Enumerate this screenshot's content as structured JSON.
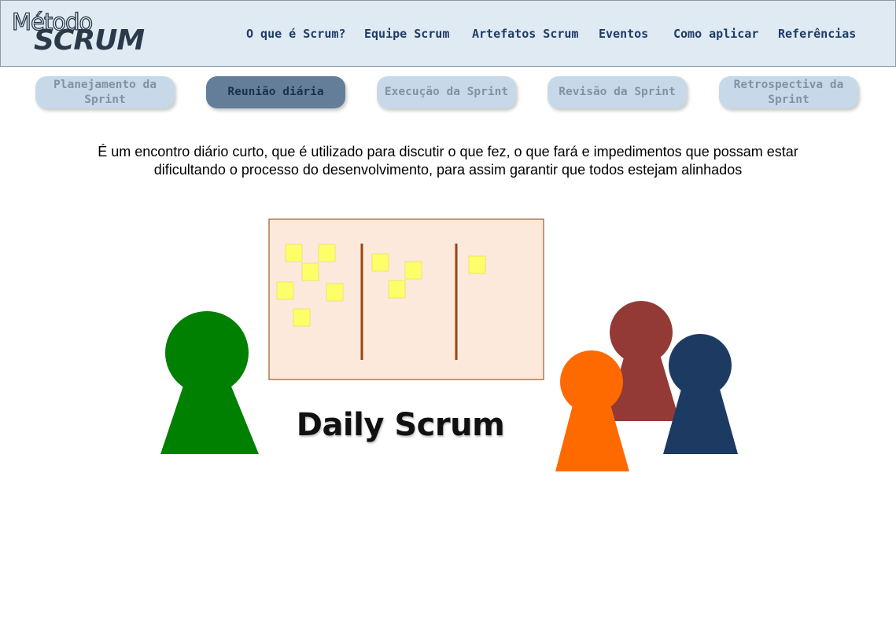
{
  "logo": {
    "line1": "Método",
    "line2": "SCRUM"
  },
  "nav": [
    {
      "label": "O que é Scrum?"
    },
    {
      "label": "Equipe Scrum"
    },
    {
      "label": "Artefatos Scrum"
    },
    {
      "label": "Eventos"
    },
    {
      "label": "Como aplicar"
    },
    {
      "label": "Referências"
    }
  ],
  "tabs": [
    {
      "label": "Planejamento da Sprint",
      "active": false
    },
    {
      "label": "Reunião diária",
      "active": true
    },
    {
      "label": "Execução da Sprint",
      "active": false
    },
    {
      "label": "Revisão da Sprint",
      "active": false
    },
    {
      "label": "Retrospectiva da Sprint",
      "active": false
    }
  ],
  "description": "É um encontro diário curto, que é utilizado para discutir o que fez, o que fará e impedimentos que possam estar dificultando o processo do desenvolvimento, para assim garantir que todos estejam alinhados",
  "illustration": {
    "caption": "Daily Scrum",
    "colors": {
      "board": "#fde9dc",
      "board_border": "#9c5a2c",
      "sticky": "#fefe6a",
      "divider": "#a0420d",
      "person_green": "#008000",
      "person_orange": "#ff6a00",
      "person_red": "#943a36",
      "person_navy": "#1d3a63"
    }
  },
  "colors": {
    "header_bg": "#dfeaf3",
    "nav_text": "#1e3c66",
    "tab_bg": "#c7d9e8",
    "tab_active_bg": "#647e9a"
  }
}
